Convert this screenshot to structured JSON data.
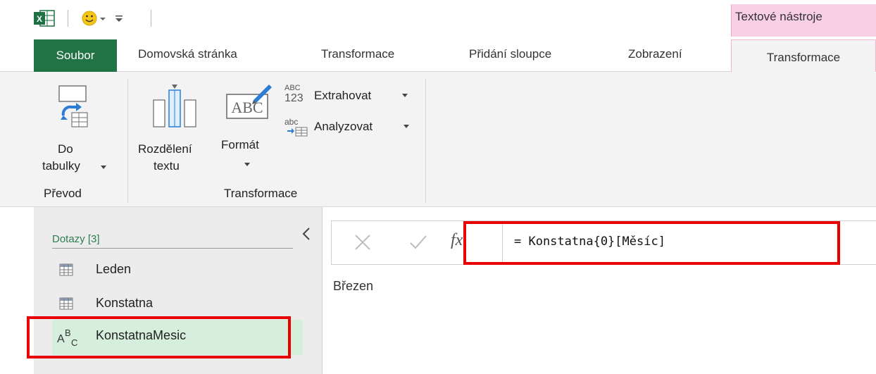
{
  "colors": {
    "file_tab": "#217346",
    "context_tab": "#f8cfe4",
    "highlight": "#ea0000",
    "selected_query": "#d6eedc"
  },
  "titlebar": {
    "context_group": "Textové nástroje",
    "app_icon": "excel-icon",
    "qat_icon": "smiley-icon"
  },
  "tabs": {
    "file": "Soubor",
    "home": "Domovská stránka",
    "transform": "Transformace",
    "add_column": "Přidání sloupce",
    "view": "Zobrazení",
    "text_transform": "Transformace"
  },
  "ribbon": {
    "to_table": {
      "line1": "Do",
      "line2": "tabulky",
      "icon": "to-table-icon"
    },
    "group_prevod": "Převod",
    "split": {
      "line1": "Rozdělení",
      "line2": "textu",
      "icon": "split-column-icon"
    },
    "format": {
      "line1": "Formát",
      "icon": "format-abc-icon"
    },
    "extract": {
      "label": "Extrahovat",
      "icon_top": "ABC",
      "icon_bottom": "123"
    },
    "parse": {
      "label": "Analyzovat",
      "icon": "abc"
    },
    "group_transform": "Transformace"
  },
  "queries": {
    "header": "Dotazy [3]",
    "items": [
      {
        "label": "Leden",
        "icon": "table-icon"
      },
      {
        "label": "Konstatna",
        "icon": "table-icon"
      },
      {
        "label": "KonstatnaMesic",
        "icon": "text-type-icon"
      }
    ]
  },
  "formula": {
    "fx": "fx",
    "text": "= Konstatna{0}[Měsíc]"
  },
  "preview": {
    "value": "Březen"
  }
}
